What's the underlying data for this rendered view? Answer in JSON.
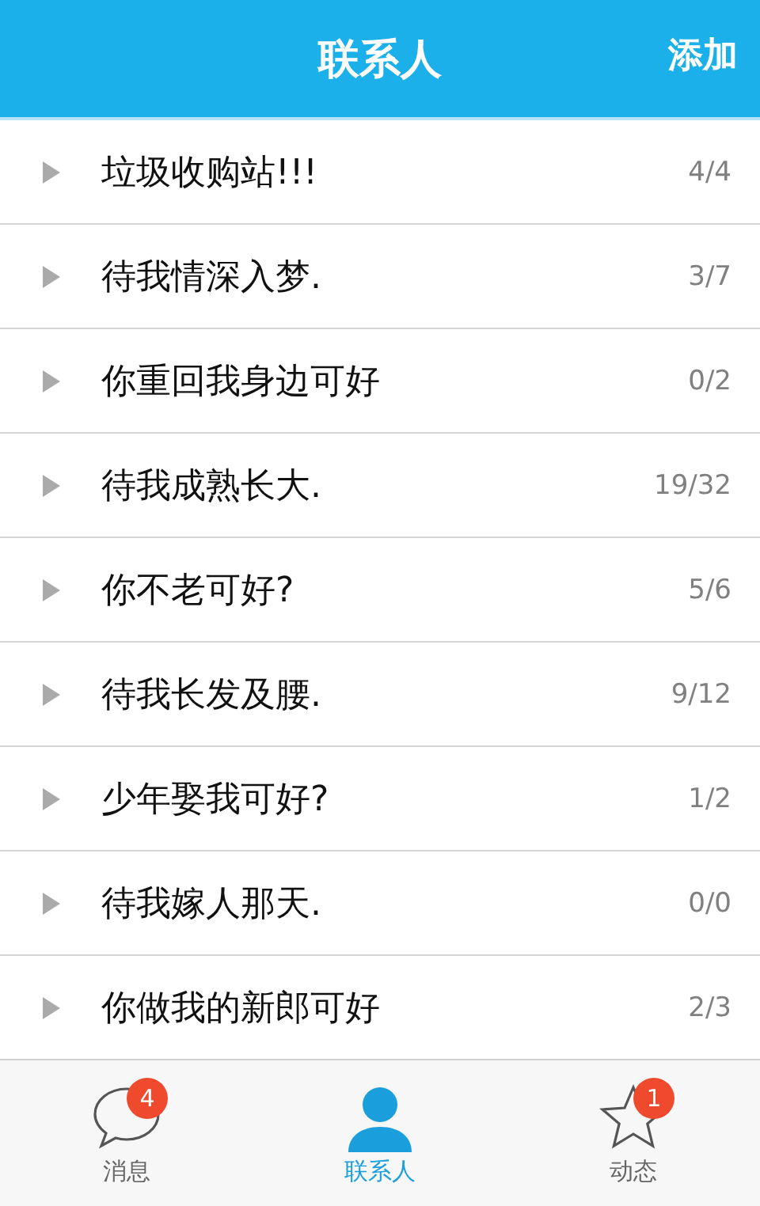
{
  "header": {
    "title": "联系人",
    "action": "添加"
  },
  "groups": [
    {
      "name": "垃圾收购站!!!",
      "count": "4/4",
      "expanded": false
    },
    {
      "name": "待我情深入梦.",
      "count": "3/7",
      "expanded": false
    },
    {
      "name": "你重回我身边可好",
      "count": "0/2",
      "expanded": false
    },
    {
      "name": "待我成熟长大.",
      "count": "19/32",
      "expanded": false
    },
    {
      "name": "你不老可好?",
      "count": "5/6",
      "expanded": false
    },
    {
      "name": "待我长发及腰.",
      "count": "9/12",
      "expanded": false
    },
    {
      "name": "少年娶我可好?",
      "count": "1/2",
      "expanded": false
    },
    {
      "name": "待我嫁人那天.",
      "count": "0/0",
      "expanded": false
    },
    {
      "name": "你做我的新郎可好",
      "count": "2/3",
      "expanded": false
    }
  ],
  "tabs": [
    {
      "kind": "chat",
      "label": "消息",
      "badge": "4",
      "selected": false
    },
    {
      "kind": "person",
      "label": "联系人",
      "selected": true
    },
    {
      "kind": "star",
      "label": "动态",
      "badge": "1",
      "selected": false
    }
  ]
}
